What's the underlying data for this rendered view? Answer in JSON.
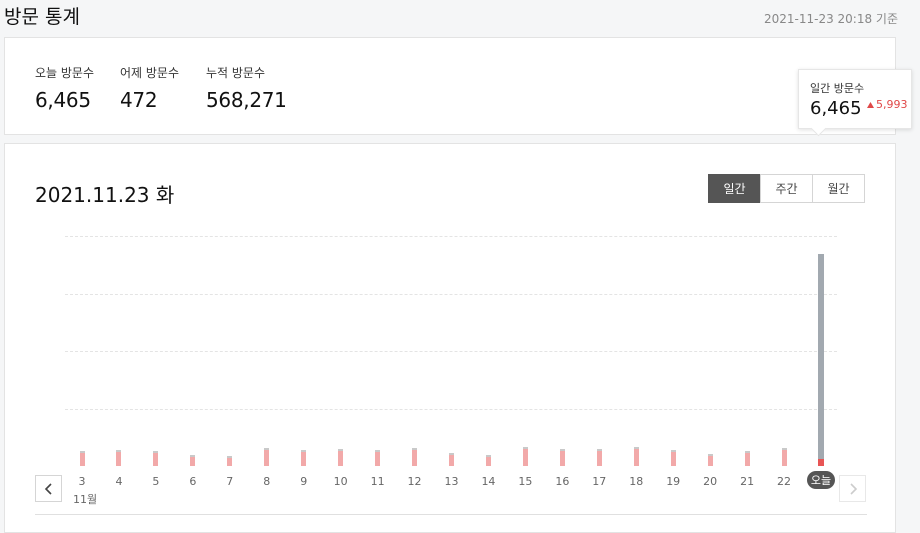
{
  "header": {
    "title": "방문 통계",
    "timestamp": "2021-11-23 20:18 기준"
  },
  "summary": {
    "stats": [
      {
        "label": "오늘 방문수",
        "value": "6,465"
      },
      {
        "label": "어제 방문수",
        "value": "472"
      },
      {
        "label": "누적 방문수",
        "value": "568,271"
      }
    ]
  },
  "chart_panel": {
    "date": "2021.11.23 화",
    "tabs": [
      {
        "label": "일간",
        "active": true
      },
      {
        "label": "주간",
        "active": false
      },
      {
        "label": "월간",
        "active": false
      }
    ],
    "tooltip": {
      "label": "일간 방문수",
      "value": "6,465",
      "delta_icon": "triangle-up-icon",
      "delta": "5,993"
    },
    "month_label": "11월",
    "prev_icon": "chevron-left-icon",
    "next_icon": "chevron-right-icon"
  },
  "chart_data": {
    "type": "bar",
    "categories": [
      "3",
      "4",
      "5",
      "6",
      "7",
      "8",
      "9",
      "10",
      "11",
      "12",
      "13",
      "14",
      "15",
      "16",
      "17",
      "18",
      "19",
      "20",
      "21",
      "22",
      "오늘"
    ],
    "values": [
      460,
      480,
      450,
      330,
      300,
      540,
      500,
      510,
      500,
      540,
      410,
      340,
      580,
      520,
      520,
      590,
      500,
      350,
      450,
      540,
      6465
    ],
    "highlight_index": 20,
    "ylim": [
      0,
      7000
    ],
    "grid": true,
    "colors": {
      "bar": "#f2a9a9",
      "today_bar": "#a2a9b0",
      "today_marker": "#e85555"
    }
  }
}
